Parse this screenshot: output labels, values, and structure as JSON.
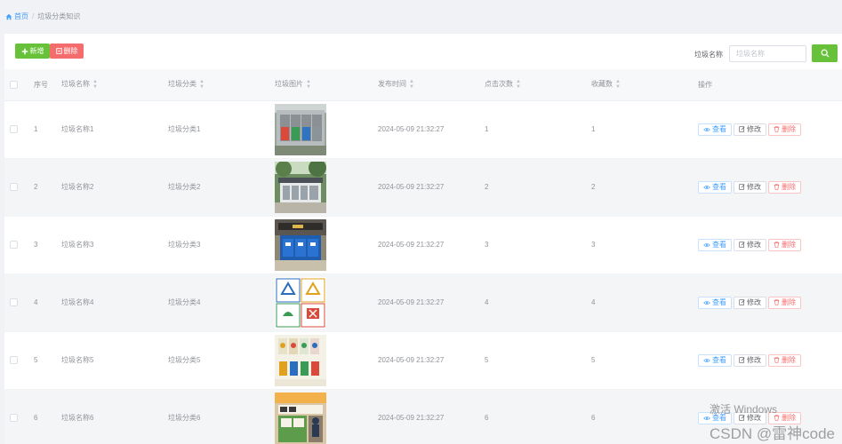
{
  "breadcrumb": {
    "home": "首页",
    "separator": "/",
    "current": "垃圾分类知识"
  },
  "toolbar": {
    "add_label": "新增",
    "delete_label": "删除"
  },
  "search": {
    "label": "垃圾名称",
    "placeholder": "垃圾名称",
    "value": ""
  },
  "table": {
    "columns": [
      "序号",
      "垃圾名称",
      "垃圾分类",
      "垃圾图片",
      "发布时间",
      "点击次数",
      "收藏数",
      "操作"
    ],
    "actions": {
      "view": "查看",
      "edit": "修改",
      "delete": "删除"
    },
    "rows": [
      {
        "index": "1",
        "name": "垃圾名称1",
        "category": "垃圾分类1",
        "image": "outdoor-bins-four-colors",
        "time": "2024-05-09 21:32:27",
        "clicks": "1",
        "favorites": "1"
      },
      {
        "index": "2",
        "name": "垃圾名称2",
        "category": "垃圾分类2",
        "image": "bin-station-under-trees",
        "time": "2024-05-09 21:32:27",
        "clicks": "2",
        "favorites": "2"
      },
      {
        "index": "3",
        "name": "垃圾名称3",
        "category": "垃圾分类3",
        "image": "blue-bins-in-building",
        "time": "2024-05-09 21:32:27",
        "clicks": "3",
        "favorites": "3"
      },
      {
        "index": "4",
        "name": "垃圾名称4",
        "category": "垃圾分类4",
        "image": "four-category-symbols",
        "time": "2024-05-09 21:32:27",
        "clicks": "4",
        "favorites": "4"
      },
      {
        "index": "5",
        "name": "垃圾名称5",
        "category": "垃圾分类5",
        "image": "sorting-poster-bins",
        "time": "2024-05-09 21:32:27",
        "clicks": "5",
        "favorites": "5"
      },
      {
        "index": "6",
        "name": "垃圾名称6",
        "category": "垃圾分类6",
        "image": "indoor-sorting-station",
        "time": "2024-05-09 21:32:27",
        "clicks": "6",
        "favorites": "6"
      }
    ]
  },
  "watermarks": {
    "windows": "激活 Windows",
    "csdn": "CSDN @雷神code"
  },
  "colors": {
    "success": "#67c23a",
    "danger": "#f56c6c",
    "primary": "#409eff"
  }
}
